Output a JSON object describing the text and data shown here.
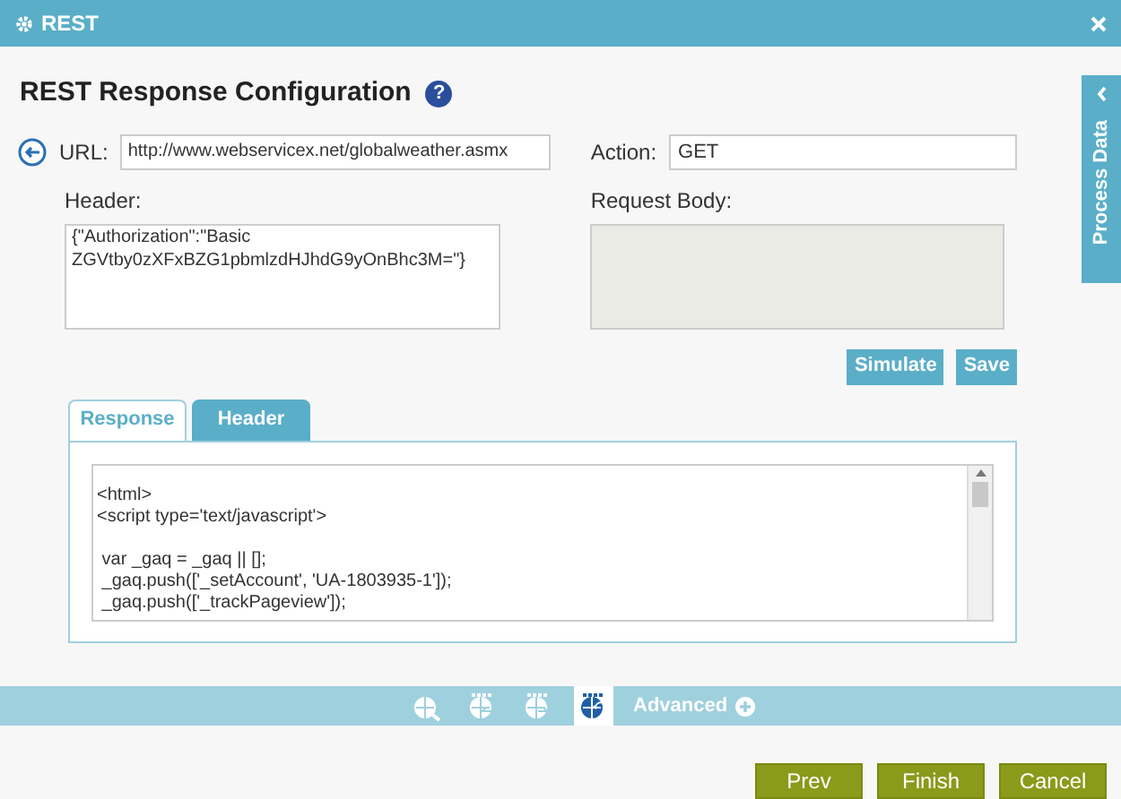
{
  "window": {
    "title": "REST"
  },
  "heading": "REST Response Configuration",
  "url": {
    "label": "URL:",
    "value": "http://www.webservicex.net/globalweather.asmx"
  },
  "action": {
    "label": "Action:",
    "value": "GET"
  },
  "header": {
    "label": "Header:",
    "value": "{\"Authorization\":\"Basic ZGVtby0zXFxBZG1pbmlzdHJhdG9yOnBhc3M=\"}"
  },
  "request_body": {
    "label": "Request Body:",
    "disabled": true
  },
  "actions": [
    "Simulate",
    "Save"
  ],
  "side_tab": "Process Data",
  "tabs": [
    {
      "label": "Response",
      "selected": true
    },
    {
      "label": "Header",
      "selected": false
    }
  ],
  "response_blocks": [
    [
      "<html>",
      "<script type='text/javascript'>"
    ],
    [
      " var _gaq = _gaq || [];",
      " _gaq.push(['_setAccount', 'UA-1803935-1']);",
      " _gaq.push(['_trackPageview']);"
    ]
  ],
  "help_icon": "?",
  "steps": [
    {
      "kind": "globe",
      "selected": false
    },
    {
      "kind": "left",
      "selected": false
    },
    {
      "kind": "right",
      "selected": false
    },
    {
      "kind": "back",
      "selected": true
    }
  ],
  "advanced": "Advanced",
  "footer": [
    "Prev",
    "Finish",
    "Cancel"
  ]
}
